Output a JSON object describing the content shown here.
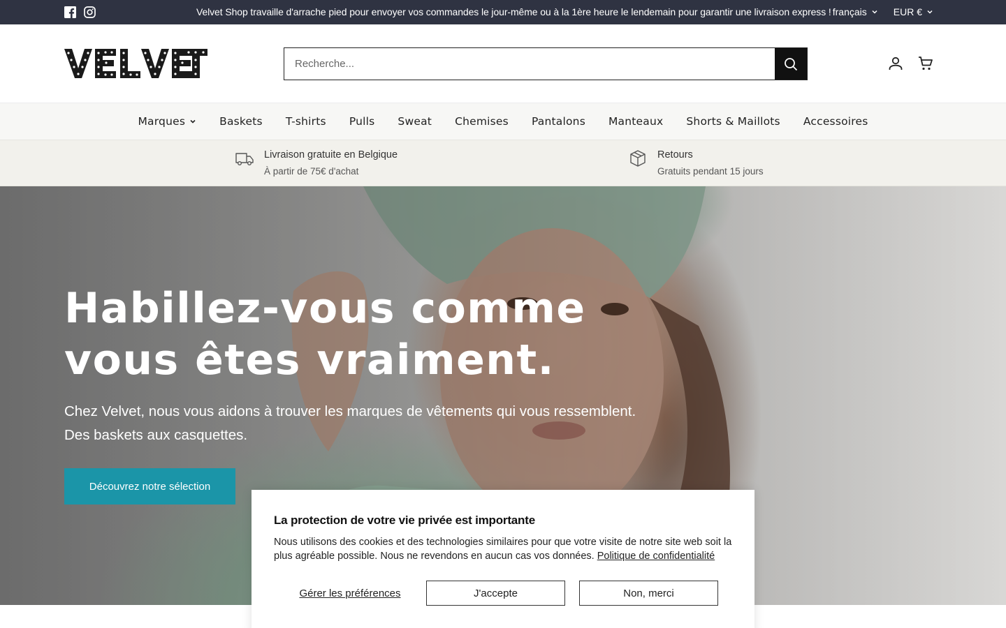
{
  "topbar": {
    "message": "Velvet Shop travaille d'arrache pied pour envoyer vos commandes le jour-même ou à la 1ère heure le lendemain pour garantir une livraison express !",
    "language": "français",
    "currency": "EUR €",
    "social": [
      "facebook-icon",
      "instagram-icon"
    ]
  },
  "header": {
    "logo_text": "VELVET",
    "search_placeholder": "Recherche..."
  },
  "nav": {
    "items": [
      "Marques",
      "Baskets",
      "T-shirts",
      "Pulls",
      "Sweat",
      "Chemises",
      "Pantalons",
      "Manteaux",
      "Shorts & Maillots",
      "Accessoires"
    ]
  },
  "benefits": [
    {
      "title": "Livraison gratuite en Belgique",
      "subtitle": "À partir de 75€ d'achat",
      "icon": "truck-icon"
    },
    {
      "title": "Retours",
      "subtitle": "Gratuits pendant 15 jours",
      "icon": "box-icon"
    }
  ],
  "hero": {
    "title": "Habillez-vous comme vous êtes vraiment.",
    "subtitle": "Chez Velvet, nous vous aidons à trouver les marques de vêtements qui vous ressemblent. Des baskets aux casquettes.",
    "cta": "Découvrez notre sélection"
  },
  "cookie": {
    "title": "La protection de votre vie privée est importante",
    "text": "Nous utilisons des cookies et des technologies similaires pour que votre visite de notre site web soit la plus agréable possible. Nous ne revendons en aucun cas vos données.",
    "policy_link": "Politique de confidentialité",
    "manage": "Gérer les préférences",
    "accept": "J'accepte",
    "decline": "Non, merci"
  },
  "colors": {
    "topbar": "#2f3342",
    "cta": "#1b95a8",
    "nav_bg": "#f7f7f5",
    "benefits_bg": "#f2f1ec"
  }
}
